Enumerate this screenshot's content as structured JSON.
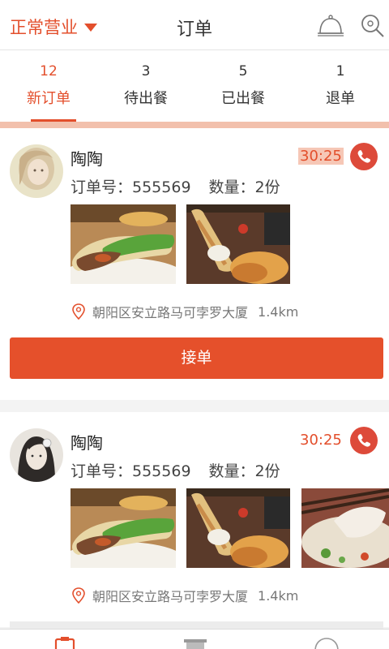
{
  "header": {
    "status_label": "正常营业",
    "title": "订单",
    "bell_icon": "bell-icon",
    "search_icon": "search-icon"
  },
  "tabs": [
    {
      "count": "12",
      "label": "新订单",
      "active": true
    },
    {
      "count": "3",
      "label": "待出餐",
      "active": false
    },
    {
      "count": "5",
      "label": "已出餐",
      "active": false
    },
    {
      "count": "1",
      "label": "退单",
      "active": false
    }
  ],
  "orders": [
    {
      "name": "陶陶",
      "timer": "30:25",
      "order_label": "订单号：555569",
      "qty_label": "数量：2份",
      "address": "朝阳区安立路马可孛罗大厦",
      "distance": "1.4km",
      "accept_label": "接单"
    },
    {
      "name": "陶陶",
      "timer": "30:25",
      "order_label": "订单号：555569",
      "qty_label": "数量：2份",
      "address": "朝阳区安立路马可孛罗大厦",
      "distance": "1.4km"
    }
  ],
  "colors": {
    "accent": "#e34f2c",
    "button": "#e5502b",
    "phone": "#dd4a3a",
    "timer_highlight": "#f6c7b6"
  }
}
